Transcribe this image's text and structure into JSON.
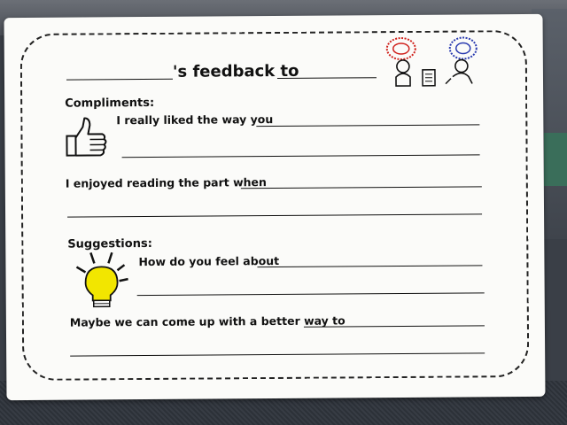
{
  "form": {
    "title_part": "'s feedback to",
    "compliments_label": "Compliments:",
    "liked_prompt": "I really liked the way you",
    "enjoyed_prompt": "I enjoyed reading the part when",
    "suggestions_label": "Suggestions:",
    "feel_prompt": "How do you feel about",
    "better_way_prompt": "Maybe we can come up with a better way to"
  },
  "icons": {
    "thumbs": "thumbs-up-icon",
    "bulb": "light-bulb-icon",
    "people": "discussion-people-icon"
  },
  "colors": {
    "bulb_yellow": "#f2e600",
    "bubble_red": "#d0231e",
    "bubble_blue": "#2a3bb0"
  }
}
